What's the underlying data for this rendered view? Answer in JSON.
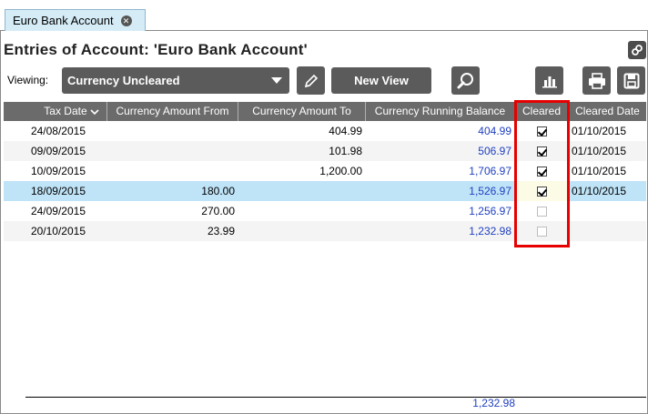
{
  "tab": {
    "label": "Euro Bank Account"
  },
  "page_title": "Entries of Account:  'Euro Bank Account'",
  "toolbar": {
    "viewing_label": "Viewing:",
    "view_selected": "Currency Uncleared",
    "new_view_label": "New View",
    "icons": [
      "pencil-icon",
      "search-icon",
      "bar-chart-icon",
      "printer-icon",
      "save-icon",
      "link-icon"
    ]
  },
  "grid": {
    "columns": [
      "Tax Date",
      "Currency Amount From",
      "Currency Amount To",
      "Currency Running Balance",
      "Cleared",
      "Cleared Date"
    ],
    "rows": [
      {
        "date": "24/08/2015",
        "from": "",
        "to": "404.99",
        "balance": "404.99",
        "cleared": true,
        "cleared_date": "01/10/2015"
      },
      {
        "date": "09/09/2015",
        "from": "",
        "to": "101.98",
        "balance": "506.97",
        "cleared": true,
        "cleared_date": "01/10/2015"
      },
      {
        "date": "10/09/2015",
        "from": "",
        "to": "1,200.00",
        "balance": "1,706.97",
        "cleared": true,
        "cleared_date": "01/10/2015"
      },
      {
        "date": "18/09/2015",
        "from": "180.00",
        "to": "",
        "balance": "1,526.97",
        "cleared": true,
        "cleared_date": "01/10/2015"
      },
      {
        "date": "24/09/2015",
        "from": "270.00",
        "to": "",
        "balance": "1,256.97",
        "cleared": false,
        "cleared_date": ""
      },
      {
        "date": "20/10/2015",
        "from": "23.99",
        "to": "",
        "balance": "1,232.98",
        "cleared": false,
        "cleared_date": ""
      }
    ],
    "selected_row": 3,
    "total_balance": "1,232.98"
  },
  "colors": {
    "header_bg": "#6b6b6b",
    "button_bg": "#5b5b5b",
    "selected_row": "#bfe3f7",
    "balance_text": "#1f3fbf",
    "highlight": "#e60000",
    "tab_bg": "#d5ecf7"
  }
}
